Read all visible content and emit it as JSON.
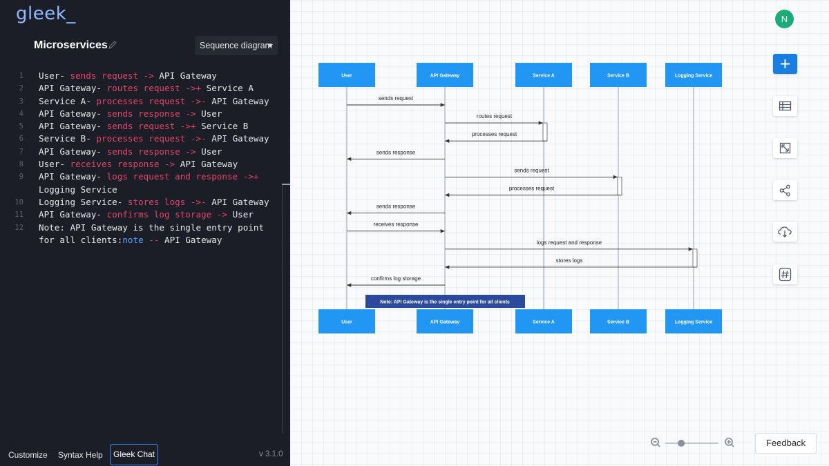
{
  "app": {
    "logo": "gleek_"
  },
  "document": {
    "title": "Microservices"
  },
  "diagram_type": {
    "selected": "Sequence diagram"
  },
  "editor": {
    "lines": [
      {
        "num": "1",
        "parts": [
          {
            "t": "User- ",
            "c": "txt"
          },
          {
            "t": "sends request",
            "c": "kw"
          },
          {
            "t": " -> ",
            "c": "kw"
          },
          {
            "t": "API Gateway",
            "c": "txt"
          }
        ]
      },
      {
        "num": "2",
        "parts": [
          {
            "t": "API Gateway- ",
            "c": "txt"
          },
          {
            "t": "routes request",
            "c": "kw"
          },
          {
            "t": " ->+ ",
            "c": "kw"
          },
          {
            "t": "Service A",
            "c": "txt"
          }
        ]
      },
      {
        "num": "3",
        "parts": [
          {
            "t": "Service A- ",
            "c": "txt"
          },
          {
            "t": "processes request",
            "c": "kw"
          },
          {
            "t": " ->- ",
            "c": "kw"
          },
          {
            "t": "API Gateway",
            "c": "txt"
          }
        ]
      },
      {
        "num": "4",
        "parts": [
          {
            "t": "API Gateway- ",
            "c": "txt"
          },
          {
            "t": "sends response",
            "c": "kw"
          },
          {
            "t": " -> ",
            "c": "kw"
          },
          {
            "t": "User",
            "c": "txt"
          }
        ]
      },
      {
        "num": "5",
        "parts": [
          {
            "t": "API Gateway- ",
            "c": "txt"
          },
          {
            "t": "sends request",
            "c": "kw"
          },
          {
            "t": " ->+ ",
            "c": "kw"
          },
          {
            "t": "Service B",
            "c": "txt"
          }
        ]
      },
      {
        "num": "6",
        "parts": [
          {
            "t": "Service B- ",
            "c": "txt"
          },
          {
            "t": "processes request",
            "c": "kw"
          },
          {
            "t": " ->- ",
            "c": "kw"
          },
          {
            "t": "API Gateway",
            "c": "txt"
          }
        ]
      },
      {
        "num": "7",
        "parts": [
          {
            "t": "API Gateway- ",
            "c": "txt"
          },
          {
            "t": "sends response",
            "c": "kw"
          },
          {
            "t": " -> ",
            "c": "kw"
          },
          {
            "t": "User",
            "c": "txt"
          }
        ]
      },
      {
        "num": "8",
        "parts": [
          {
            "t": "User- ",
            "c": "txt"
          },
          {
            "t": "receives response",
            "c": "kw"
          },
          {
            "t": " -> ",
            "c": "kw"
          },
          {
            "t": "API Gateway",
            "c": "txt"
          }
        ]
      },
      {
        "num": "9",
        "parts": [
          {
            "t": "API Gateway- ",
            "c": "txt"
          },
          {
            "t": "logs request and response",
            "c": "kw"
          },
          {
            "t": " ->+ ",
            "c": "kw"
          },
          {
            "t": "Logging Service",
            "c": "txt"
          }
        ]
      },
      {
        "num": "10",
        "parts": [
          {
            "t": "Logging Service- ",
            "c": "txt"
          },
          {
            "t": "stores logs",
            "c": "kw"
          },
          {
            "t": " ->- ",
            "c": "kw"
          },
          {
            "t": "API Gateway",
            "c": "txt"
          }
        ]
      },
      {
        "num": "11",
        "parts": [
          {
            "t": "API Gateway- ",
            "c": "txt"
          },
          {
            "t": "confirms log storage",
            "c": "kw"
          },
          {
            "t": " -> ",
            "c": "kw"
          },
          {
            "t": "User",
            "c": "txt"
          }
        ]
      },
      {
        "num": "12",
        "parts": [
          {
            "t": "Note: API Gateway is the single entry point for all clients:",
            "c": "txt"
          },
          {
            "t": "note",
            "c": "nt"
          },
          {
            "t": " -- ",
            "c": "kw"
          },
          {
            "t": "API Gateway",
            "c": "txt"
          }
        ]
      }
    ]
  },
  "footer": {
    "customize": "Customize",
    "syntax_help": "Syntax Help",
    "gleek_chat": "Gleek Chat",
    "version": "v 3.1.0"
  },
  "user": {
    "initial": "N"
  },
  "toolbar": {
    "icons": [
      "plus-icon",
      "table-icon",
      "expand-icon",
      "share-icon",
      "cloud-download-icon",
      "hashtag-icon"
    ]
  },
  "zoom": {
    "level": 0.3
  },
  "feedback_label": "Feedback",
  "sequence": {
    "participants": [
      "User",
      "API Gateway",
      "Service A",
      "Service B",
      "Logging Service"
    ],
    "messages": [
      {
        "from": 0,
        "to": 1,
        "label": "sends request"
      },
      {
        "from": 1,
        "to": 2,
        "label": "routes request",
        "activate": true
      },
      {
        "from": 2,
        "to": 1,
        "label": "processes request",
        "return": true
      },
      {
        "from": 1,
        "to": 0,
        "label": "sends response"
      },
      {
        "from": 1,
        "to": 3,
        "label": "sends request",
        "activate": true
      },
      {
        "from": 3,
        "to": 1,
        "label": "processes request",
        "return": true
      },
      {
        "from": 1,
        "to": 0,
        "label": "sends response"
      },
      {
        "from": 0,
        "to": 1,
        "label": "receives response"
      },
      {
        "from": 1,
        "to": 4,
        "label": "logs request and response",
        "activate": true
      },
      {
        "from": 4,
        "to": 1,
        "label": "stores logs",
        "return": true
      },
      {
        "from": 1,
        "to": 0,
        "label": "confirms log storage"
      }
    ],
    "note": "Note: API Gateway is the single entry point for all clients",
    "colors": {
      "participant": "#2196f3",
      "note": "#2b4a9c",
      "line": "#333333"
    }
  }
}
